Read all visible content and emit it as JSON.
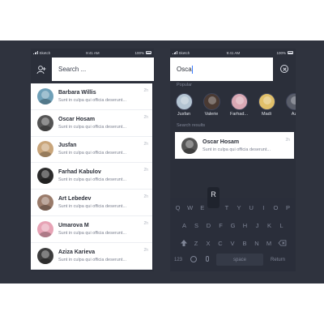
{
  "colors": {
    "stage": "#2f333e",
    "phone": "#2b2f3a",
    "accent": "#3b7bff",
    "card": "#ffffff"
  },
  "statusbar": {
    "carrier": "Sketch",
    "time": "9:41 AM",
    "battery": "100%"
  },
  "left_screen": {
    "header": {
      "add_contact_icon": "add-person-icon",
      "search_placeholder": "Search ..."
    },
    "contacts": [
      {
        "name": "Barbara Willis",
        "message": "Sunt in culpa qui officia deserunt...",
        "time": "2h",
        "avatar_color": "#6fa0b8"
      },
      {
        "name": "Oscar Hosam",
        "message": "Sunt in culpa qui officia deserunt...",
        "time": "2h",
        "avatar_color": "#555555"
      },
      {
        "name": "Jusfan",
        "message": "Sunt in culpa qui officia deserunt...",
        "time": "2h",
        "avatar_color": "#c9a57a"
      },
      {
        "name": "Farhad Kabulov",
        "message": "Sunt in culpa qui officia deserunt...",
        "time": "2h",
        "avatar_color": "#2c2c2c"
      },
      {
        "name": "Art Lebedev",
        "message": "Sunt in culpa qui officia deserunt...",
        "time": "2h",
        "avatar_color": "#9a7b6a"
      },
      {
        "name": "Umarova M",
        "message": "Sunt in culpa qui officia deserunt...",
        "time": "2h",
        "avatar_color": "#e7a3b5"
      },
      {
        "name": "Aziza Karieva",
        "message": "Sunt in culpa qui officia deserunt...",
        "time": "2h",
        "avatar_color": "#3d3d3d"
      }
    ]
  },
  "right_screen": {
    "search_value": "Osca",
    "clear_icon": "close-circle-icon",
    "popular_label": "Popular",
    "popular": [
      {
        "name": "Jusfan",
        "avatar_color": "#b3c4d2"
      },
      {
        "name": "Valerie",
        "avatar_color": "#4a3a33"
      },
      {
        "name": "Farhad...",
        "avatar_color": "#d9a8b4"
      },
      {
        "name": "Madi",
        "avatar_color": "#e1c06a"
      },
      {
        "name": "Az",
        "avatar_color": "#5a5e6a"
      }
    ],
    "results_label": "Search results",
    "result": {
      "name": "Oscar Hosam",
      "message": "Sunt in culpa qui officia deserunt...",
      "time": "2h",
      "avatar_color": "#555555"
    },
    "keyboard": {
      "popup_key": "R",
      "row1": [
        "Q",
        "W",
        "E",
        "R",
        "T",
        "Y",
        "U",
        "I",
        "O",
        "P"
      ],
      "row2": [
        "A",
        "S",
        "D",
        "F",
        "G",
        "H",
        "J",
        "K",
        "L"
      ],
      "row3": [
        "Z",
        "X",
        "C",
        "V",
        "B",
        "N",
        "M"
      ],
      "num_key": "123",
      "space_key": "space",
      "return_key": "Return"
    }
  }
}
